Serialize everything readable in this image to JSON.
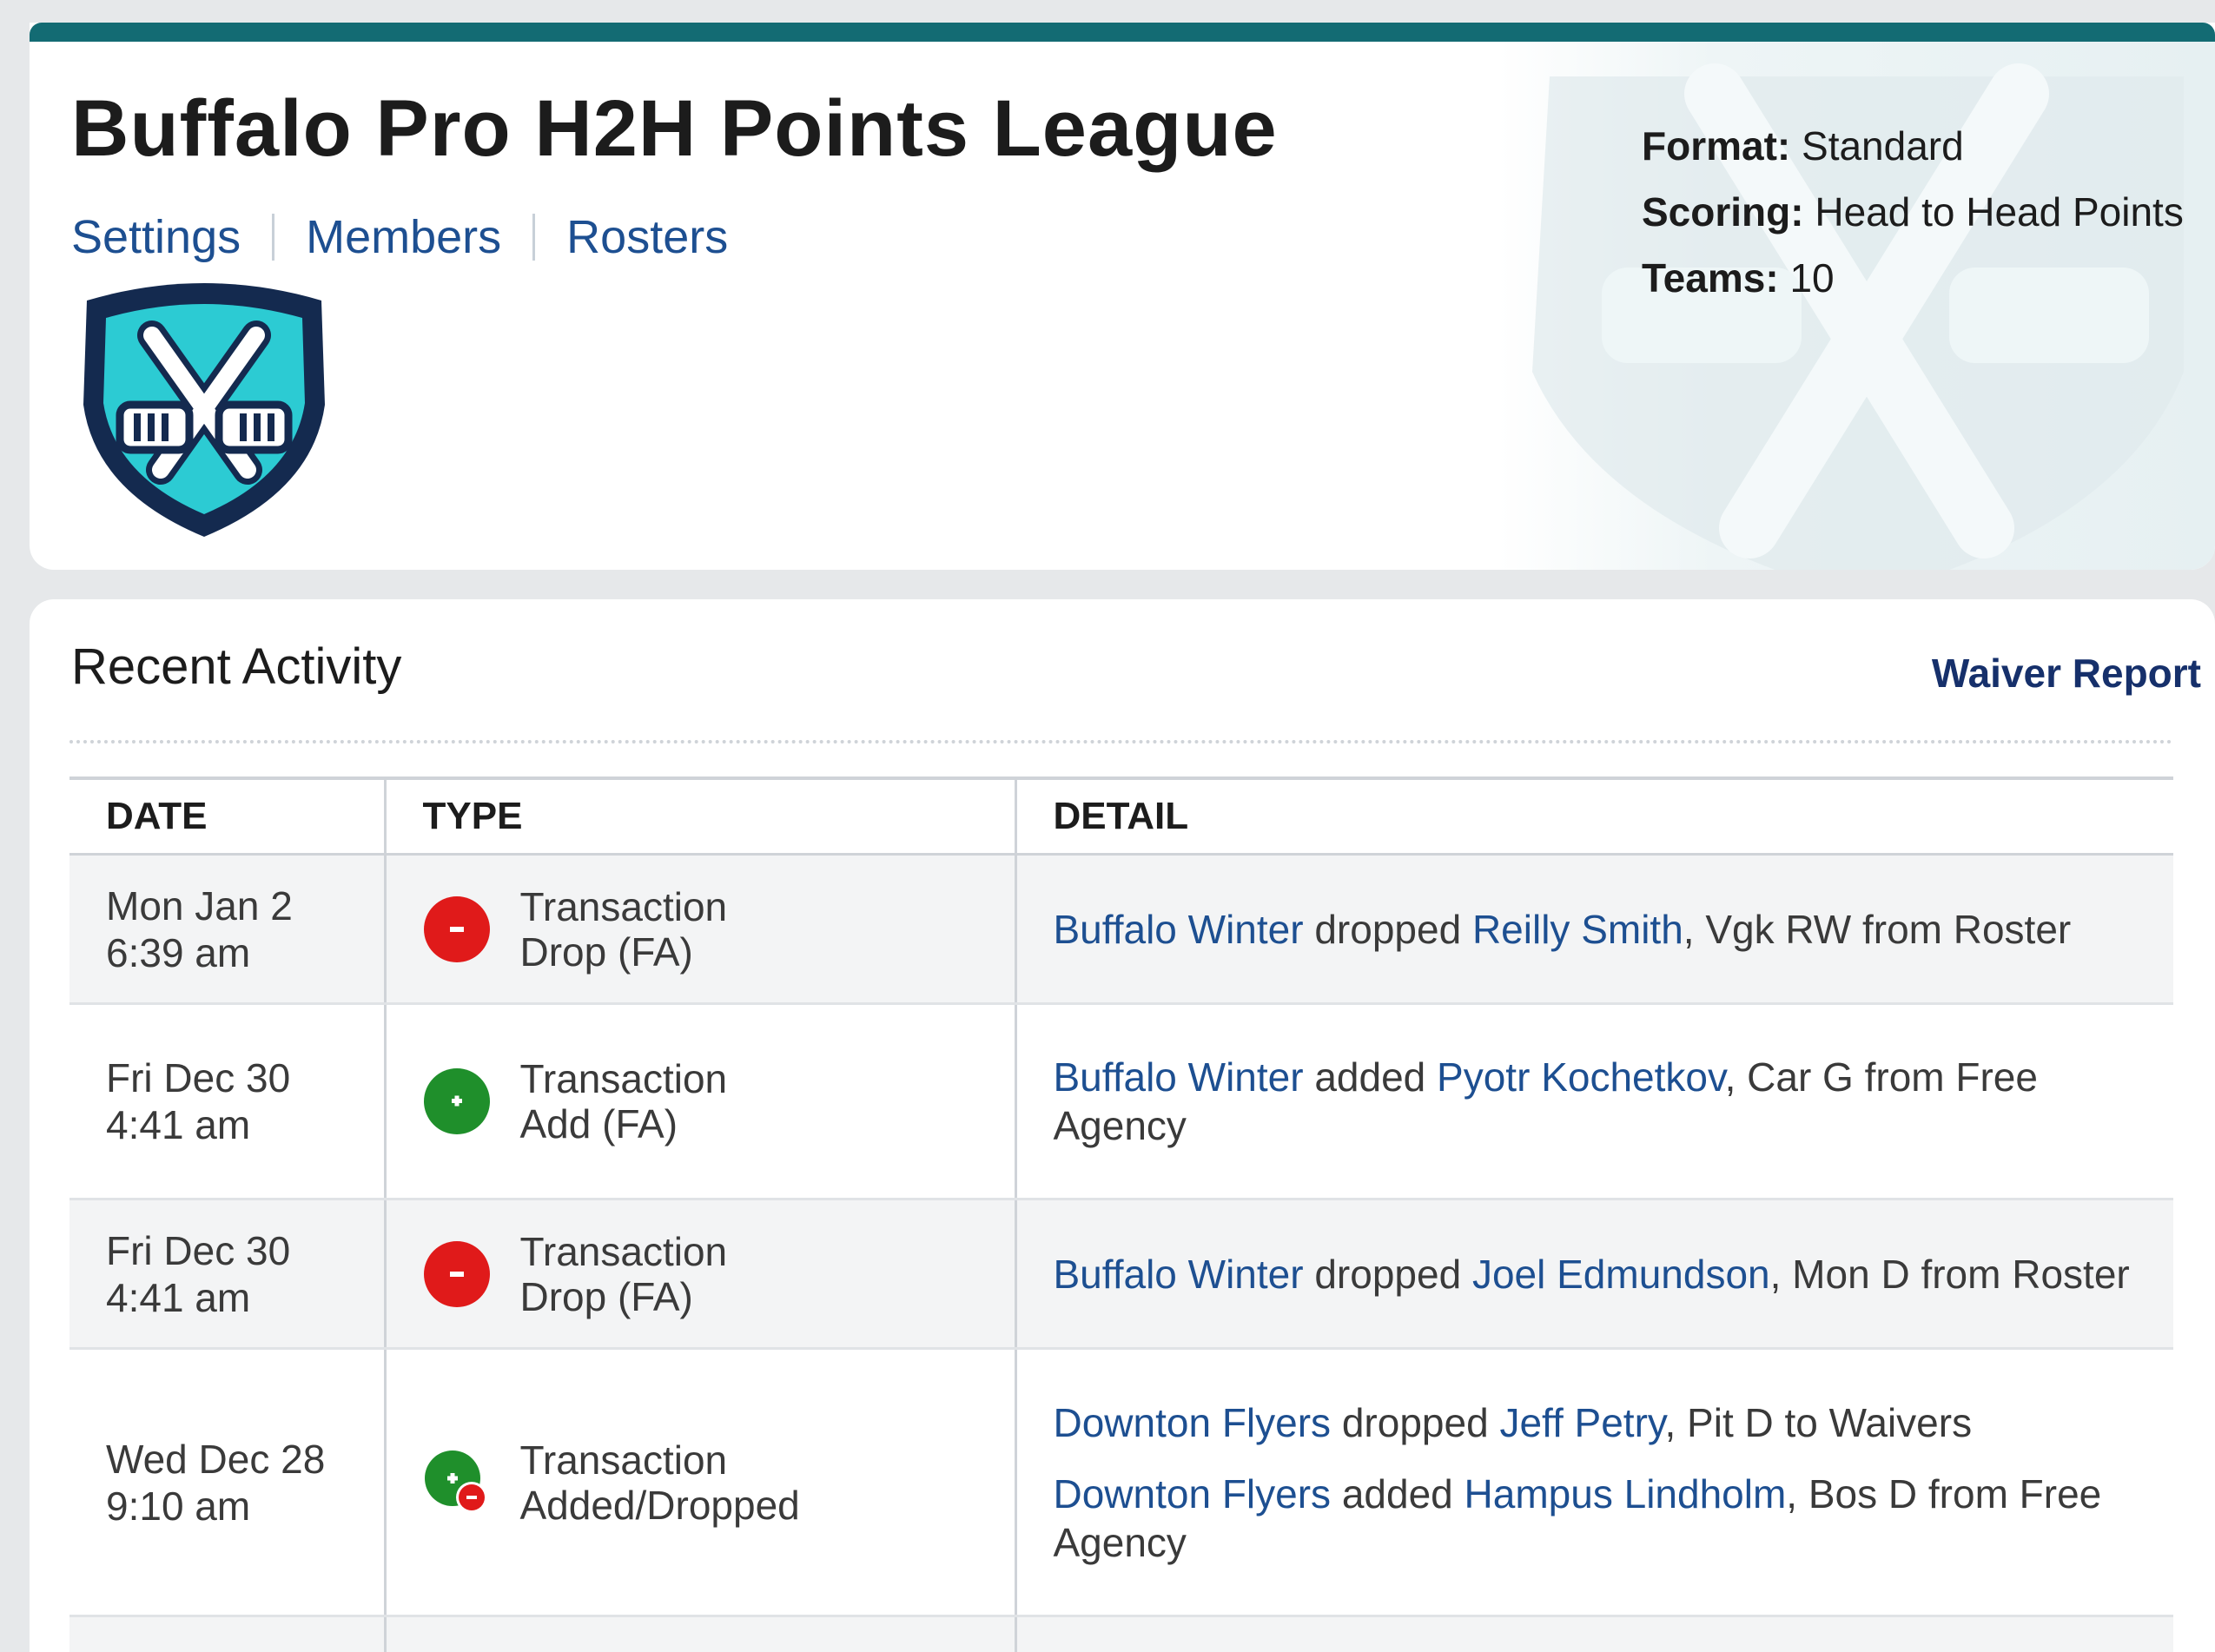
{
  "header": {
    "title": "Buffalo Pro H2H Points League",
    "nav": [
      "Settings",
      "Members",
      "Rosters"
    ],
    "meta": [
      {
        "label": "Format:",
        "value": "Standard"
      },
      {
        "label": "Scoring:",
        "value": "Head to Head Points"
      },
      {
        "label": "Teams:",
        "value": "10"
      }
    ]
  },
  "activity": {
    "title": "Recent Activity",
    "waiver_link": "Waiver Report",
    "columns": [
      "DATE",
      "TYPE",
      "DETAIL"
    ],
    "rows": [
      {
        "date": "Mon Jan 2",
        "time": "6:39 am",
        "type": "Transaction",
        "subtype": "Drop (FA)",
        "icon": "minus-circle-icon",
        "details": [
          {
            "team": "Buffalo Winter",
            "action": " dropped ",
            "player": "Reilly Smith",
            "rest": ", Vgk RW from Roster"
          }
        ]
      },
      {
        "date": "Fri Dec 30",
        "time": "4:41 am",
        "type": "Transaction",
        "subtype": "Add (FA)",
        "icon": "plus-circle-icon",
        "details": [
          {
            "team": "Buffalo Winter",
            "action": " added ",
            "player": "Pyotr Kochetkov",
            "rest": ", Car G from Free Agency"
          }
        ]
      },
      {
        "date": "Fri Dec 30",
        "time": "4:41 am",
        "type": "Transaction",
        "subtype": "Drop (FA)",
        "icon": "minus-circle-icon",
        "details": [
          {
            "team": "Buffalo Winter",
            "action": " dropped ",
            "player": "Joel Edmundson",
            "rest": ", Mon D from Roster"
          }
        ]
      },
      {
        "date": "Wed Dec 28",
        "time": "9:10 am",
        "type": "Transaction",
        "subtype": "Added/Dropped",
        "icon": "add-drop-icon",
        "details": [
          {
            "team": "Downton Flyers",
            "action": " dropped ",
            "player": "Jeff Petry",
            "rest": ", Pit D to Waivers"
          },
          {
            "team": "Downton Flyers",
            "action": " added ",
            "player": "Hampus Lindholm",
            "rest": ", Bos D from Free Agency"
          }
        ]
      }
    ]
  },
  "colors": {
    "accent_bar": "#136b73",
    "link": "#1d4f91",
    "drop_red": "#e01a1a",
    "add_green": "#1f8f2b",
    "logo_teal": "#2ccbd3",
    "logo_navy": "#142a4f"
  }
}
